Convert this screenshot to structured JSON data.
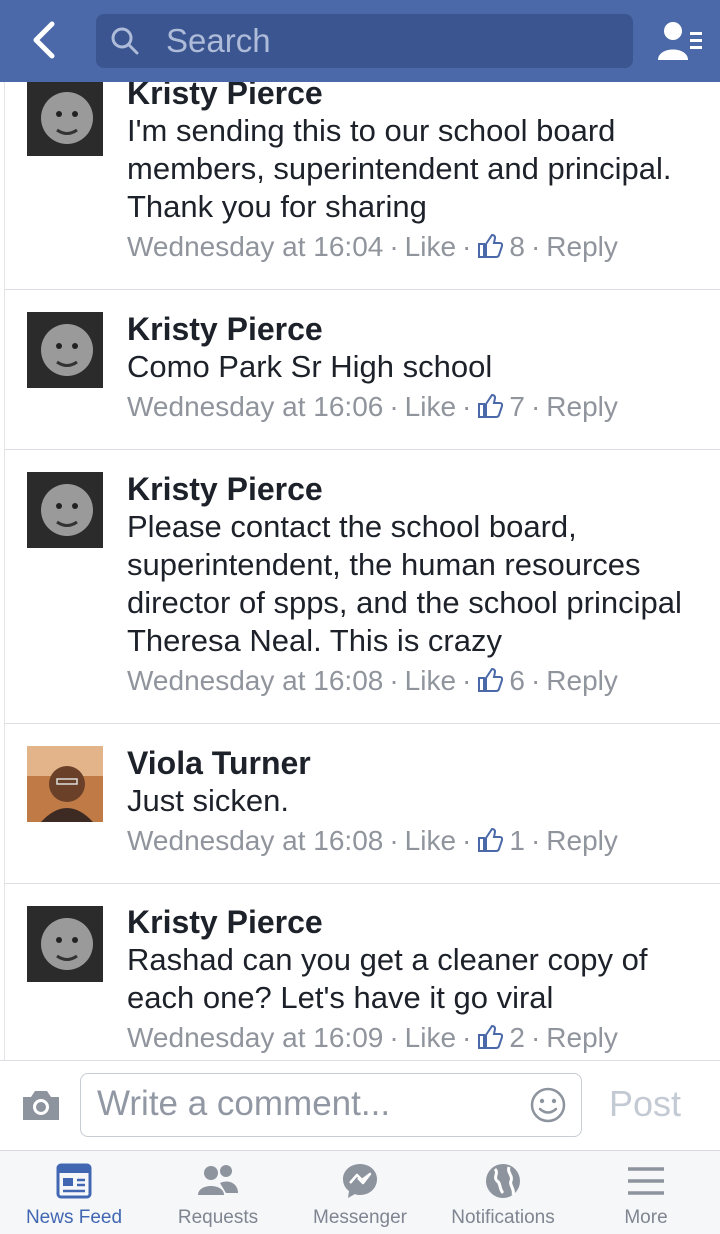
{
  "header": {
    "search_placeholder": "Search"
  },
  "comments": [
    {
      "author": "Kristy Pierce",
      "text": "I'm sending this to our school board members, superintendent and principal. Thank you for sharing",
      "time": "Wednesday at 16:04",
      "like_label": "Like",
      "like_count": "8",
      "reply_label": "Reply"
    },
    {
      "author": "Kristy Pierce",
      "text": "Como Park Sr High school",
      "time": "Wednesday at 16:06",
      "like_label": "Like",
      "like_count": "7",
      "reply_label": "Reply"
    },
    {
      "author": "Kristy Pierce",
      "text": "Please contact the school board, superintendent, the human resources director of spps, and the school principal Theresa Neal. This is crazy",
      "time": "Wednesday at 16:08",
      "like_label": "Like",
      "like_count": "6",
      "reply_label": "Reply"
    },
    {
      "author": "Viola Turner",
      "text": "Just sicken.",
      "time": "Wednesday at 16:08",
      "like_label": "Like",
      "like_count": "1",
      "reply_label": "Reply"
    },
    {
      "author": "Kristy Pierce",
      "text": "Rashad can you get a cleaner copy of each one? Let's have it go viral",
      "time": "Wednesday at 16:09",
      "like_label": "Like",
      "like_count": "2",
      "reply_label": "Reply"
    }
  ],
  "composer": {
    "placeholder": "Write a comment...",
    "post_label": "Post"
  },
  "tabs": [
    {
      "label": "News Feed",
      "icon": "news-feed-icon",
      "active": true
    },
    {
      "label": "Requests",
      "icon": "requests-icon",
      "active": false
    },
    {
      "label": "Messenger",
      "icon": "messenger-icon",
      "active": false
    },
    {
      "label": "Notifications",
      "icon": "notifications-icon",
      "active": false
    },
    {
      "label": "More",
      "icon": "more-icon",
      "active": false
    }
  ],
  "colors": {
    "brand": "#4b69a8",
    "active_tab": "#4267b2",
    "meta_text": "#90949c"
  }
}
